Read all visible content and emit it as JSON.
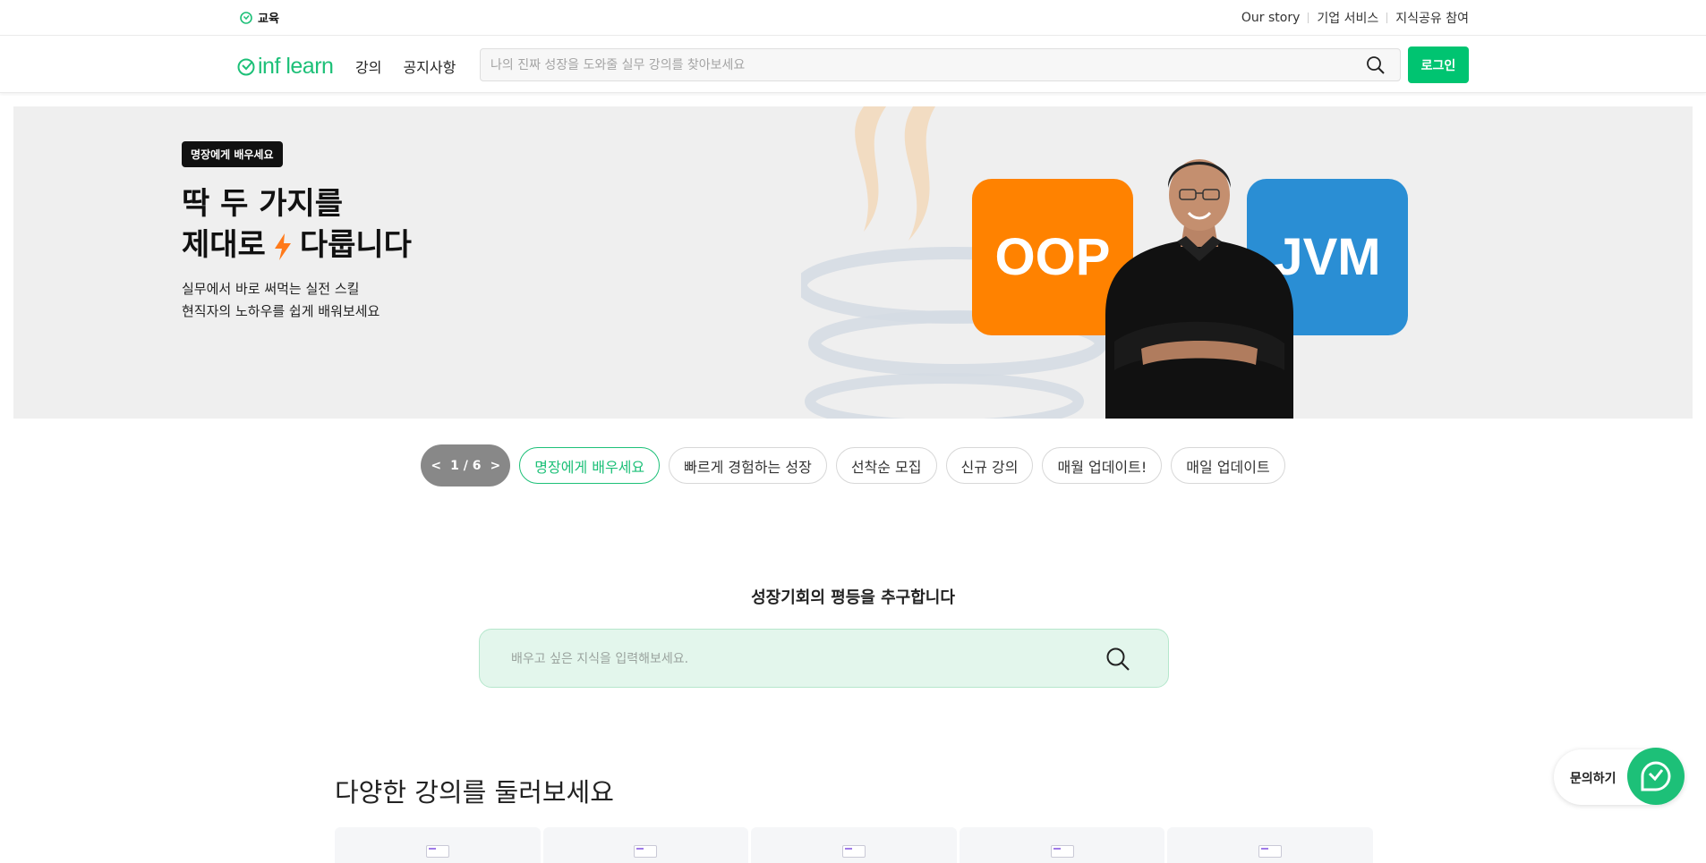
{
  "topbar": {
    "brand_tab": "교육",
    "links": [
      "Our story",
      "기업 서비스",
      "지식공유 참여"
    ]
  },
  "header": {
    "logo_text": "inf learn",
    "nav": [
      "강의",
      "공지사항"
    ],
    "search_placeholder": "나의 진짜 성장을 도와줄 실무 강의를 찾아보세요",
    "login_label": "로그인"
  },
  "hero": {
    "badge": "명장에게 배우세요",
    "title_line1": "딱 두 가지를",
    "title_line2_a": "제대로",
    "title_line2_b": "다룹니다",
    "sub_line1": "실무에서 바로 써먹는 실전 스킬",
    "sub_line2": "현직자의 노하우를 쉽게 배워보세요",
    "tile_left": "OOP",
    "tile_right": "JVM"
  },
  "carousel": {
    "prev": "<",
    "page": "1 / 6",
    "next": ">",
    "chips": [
      "명장에게 배우세요",
      "빠르게 경험하는 성장",
      "선착순 모집",
      "신규 강의",
      "매월 업데이트!",
      "매일 업데이트"
    ],
    "active_index": 0
  },
  "growth": {
    "tagline": "성장기회의 평등을 추구합니다",
    "search_placeholder": "배우고 싶은 지식을 입력해보세요."
  },
  "courses": {
    "section_title": "다양한 강의를 둘러보세요"
  },
  "inquiry": {
    "label": "문의하기"
  },
  "colors": {
    "brand": "#1dc078",
    "login": "#00c471",
    "oop_tile": "#ff8200",
    "jvm_tile": "#2a8ed4"
  },
  "icons": [
    "search-icon",
    "inflearn-logo-icon",
    "lightning-icon",
    "chat-icon"
  ]
}
